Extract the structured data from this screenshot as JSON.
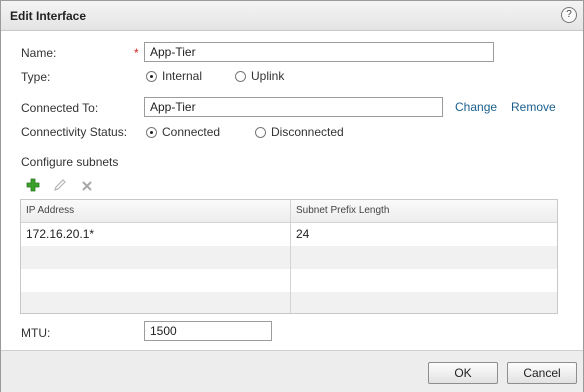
{
  "dialog": {
    "title": "Edit Interface",
    "help_icon": "?"
  },
  "form": {
    "name": {
      "label": "Name:",
      "required_marker": "*",
      "value": "App-Tier"
    },
    "type": {
      "label": "Type:",
      "options": [
        {
          "label": "Internal",
          "selected": true
        },
        {
          "label": "Uplink",
          "selected": false
        }
      ]
    },
    "connected_to": {
      "label": "Connected To:",
      "value": "App-Tier",
      "change_link": "Change",
      "remove_link": "Remove"
    },
    "connectivity_status": {
      "label": "Connectivity Status:",
      "options": [
        {
          "label": "Connected",
          "selected": true
        },
        {
          "label": "Disconnected",
          "selected": false
        }
      ]
    },
    "subnets": {
      "label": "Configure subnets",
      "toolbar_icons": [
        "add-icon",
        "edit-icon",
        "delete-icon"
      ],
      "columns": [
        "IP Address",
        "Subnet Prefix Length"
      ],
      "rows": [
        {
          "ip": "172.16.20.1*",
          "prefix": "24"
        }
      ]
    },
    "mtu": {
      "label": "MTU:",
      "value": "1500"
    }
  },
  "footer": {
    "ok_label": "OK",
    "cancel_label": "Cancel"
  },
  "colors": {
    "accent_link": "#1a5f8e",
    "required": "#d01e1e",
    "add_icon": "#3aa02a"
  }
}
